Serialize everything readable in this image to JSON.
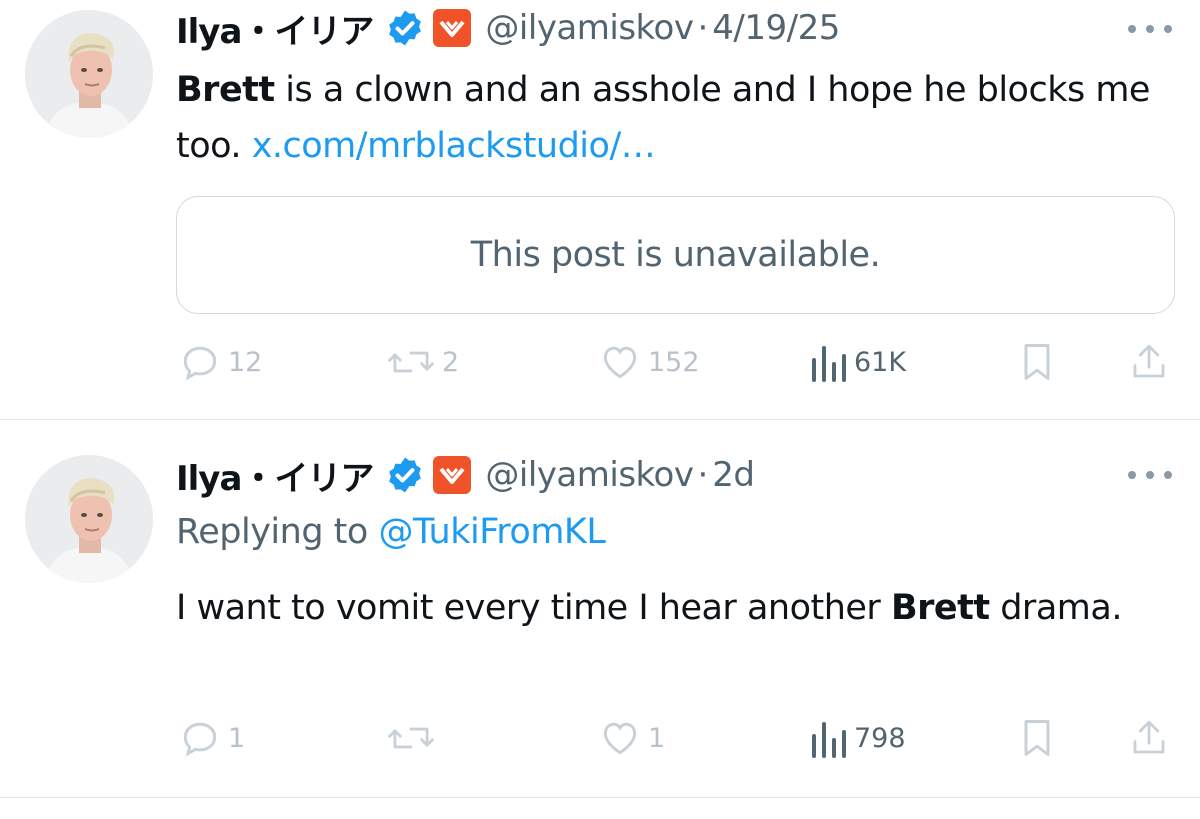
{
  "tweets": [
    {
      "name": "Ilya・イリア",
      "handle": "@ilyamiskov",
      "separator": "·",
      "time": "4/19/25",
      "text_bold": "Brett",
      "text_rest": " is a clown and an asshole and I hope he blocks me too. ",
      "link": "x.com/mrblackstudio/…",
      "quote_card": "This post is unavailable.",
      "counts": {
        "replies": "12",
        "reposts": "2",
        "likes": "152",
        "views": "61K"
      }
    },
    {
      "name": "Ilya・イリア",
      "handle": "@ilyamiskov",
      "separator": "·",
      "time": "2d",
      "replying_prefix": "Replying to",
      "replying_handle": "@TukiFromKL",
      "text_before": "I want to vomit every time I hear another ",
      "text_bold": "Brett",
      "text_after": " drama.",
      "counts": {
        "replies": "1",
        "reposts": "",
        "likes": "1",
        "views": "798"
      }
    }
  ],
  "colors": {
    "verified": "#1d9bf0",
    "affiliate_badge": "#f0532a",
    "link": "#1d9bf0",
    "muted": "#536471"
  },
  "icons": [
    "verified-icon",
    "affiliate-badge-icon",
    "more-icon",
    "reply-icon",
    "repost-icon",
    "like-icon",
    "views-icon",
    "bookmark-icon",
    "share-icon"
  ]
}
